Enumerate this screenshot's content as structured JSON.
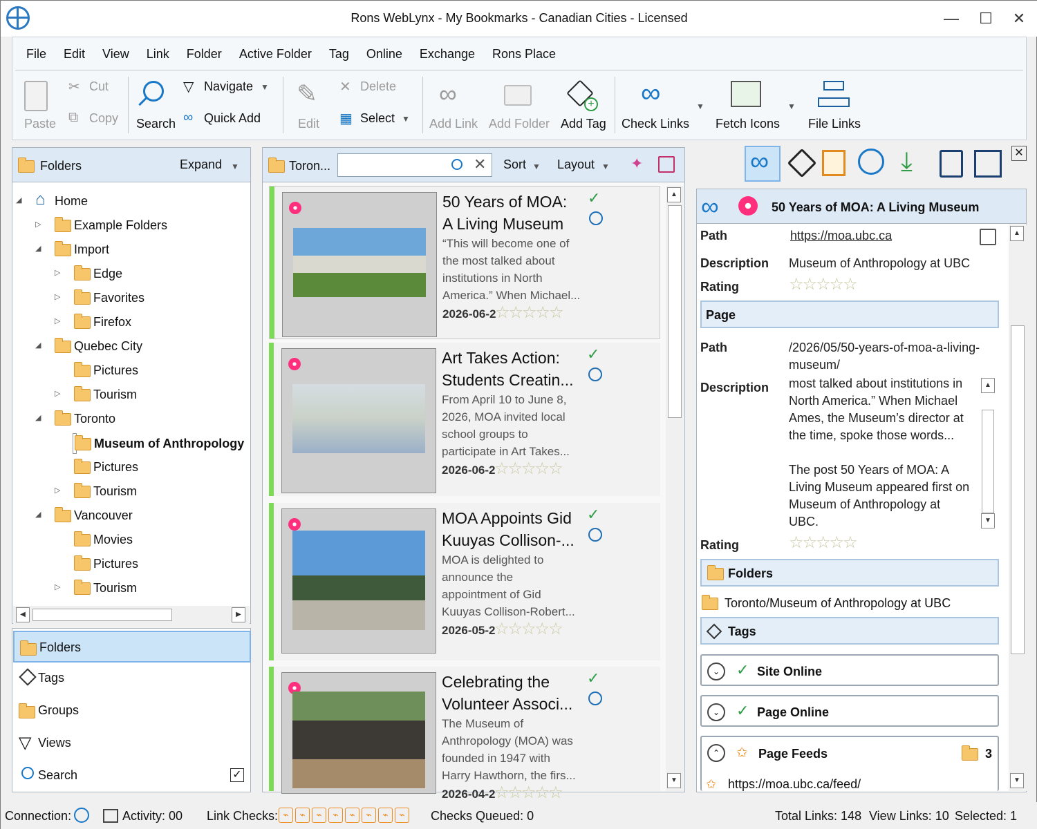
{
  "window": {
    "title": "Rons WebLynx - My Bookmarks - Canadian Cities - Licensed"
  },
  "menu": [
    "File",
    "Edit",
    "View",
    "Link",
    "Folder",
    "Active Folder",
    "Tag",
    "Online",
    "Exchange",
    "Rons Place"
  ],
  "toolbar": {
    "paste": "Paste",
    "cut": "Cut",
    "copy": "Copy",
    "search": "Search",
    "navigate": "Navigate",
    "quick_add": "Quick Add",
    "edit": "Edit",
    "delete": "Delete",
    "select": "Select",
    "add_link": "Add Link",
    "add_folder": "Add Folder",
    "add_tag": "Add Tag",
    "check_links": "Check Links",
    "fetch_icons": "Fetch Icons",
    "file_links": "File Links"
  },
  "folders_panel": {
    "title": "Folders",
    "expand": "Expand",
    "tree": [
      {
        "label": "Home"
      },
      {
        "label": "Example Folders"
      },
      {
        "label": "Import"
      },
      {
        "label": "Edge"
      },
      {
        "label": "Favorites"
      },
      {
        "label": "Firefox"
      },
      {
        "label": "Quebec City"
      },
      {
        "label": "Pictures"
      },
      {
        "label": "Tourism"
      },
      {
        "label": "Toronto"
      },
      {
        "label": "Museum of Anthropology"
      },
      {
        "label": "Pictures"
      },
      {
        "label": "Tourism"
      },
      {
        "label": "Vancouver"
      },
      {
        "label": "Movies"
      },
      {
        "label": "Pictures"
      },
      {
        "label": "Tourism"
      }
    ]
  },
  "nav": {
    "folders": "Folders",
    "tags": "Tags",
    "groups": "Groups",
    "views": "Views",
    "search": "Search"
  },
  "list_panel": {
    "folder": "Toron...",
    "search_value": "",
    "sort": "Sort",
    "layout": "Layout",
    "cards": [
      {
        "title1": "50 Years of MOA:",
        "title2": "A Living Museum",
        "desc": [
          "“This will become one of",
          "the most talked about",
          "institutions in North",
          "America.” When Michael..."
        ],
        "date": "2026-06-2"
      },
      {
        "title1": "Art Takes Action:",
        "title2": "Students Creatin...",
        "desc": [
          "From April 10 to June 8,",
          "2026, MOA invited local",
          "school groups to",
          "participate in Art Takes..."
        ],
        "date": "2026-06-2"
      },
      {
        "title1": "MOA Appoints Gid",
        "title2": "Kuuyas Collison-...",
        "desc": [
          "MOA is delighted to",
          "announce the",
          "appointment of Gid",
          "Kuuyas Collison-Robert..."
        ],
        "date": "2026-05-2"
      },
      {
        "title1": "Celebrating the",
        "title2": "Volunteer Associ...",
        "desc": [
          "The Museum of",
          "Anthropology (MOA) was",
          "founded in 1947 with",
          "Harry Hawthorn, the firs..."
        ],
        "date": "2026-04-2"
      }
    ]
  },
  "details": {
    "header": "50 Years of MOA: A Living Museum",
    "path_label": "Path",
    "path": "https://moa.ubc.ca",
    "desc_label": "Description",
    "desc": "Museum of Anthropology at UBC",
    "rating_label": "Rating",
    "page_section": "Page",
    "page_path": [
      "/2026/05/50-years-of-moa-a-living-",
      "museum/"
    ],
    "page_desc": [
      "most talked about institutions in",
      "North America.” When Michael",
      "Ames, the Museum’s director at",
      "the time, spoke those words...",
      "",
      "The post 50 Years of MOA: A",
      "Living Museum appeared first on",
      "Museum of Anthropology at",
      "UBC."
    ],
    "folders_section": "Folders",
    "folder_path": "Toronto/Museum of Anthropology at UBC",
    "tags_section": "Tags",
    "site_online": "Site Online",
    "page_online": "Page Online",
    "page_feeds": "Page Feeds",
    "feeds_count": "3",
    "feed_url": "https://moa.ubc.ca/feed/"
  },
  "status": {
    "connection": "Connection:",
    "activity": "Activity: 00",
    "link_checks": "Link Checks:",
    "checks_queued": "Checks Queued: 0",
    "total_links": "Total Links: 148",
    "view_links": "View Links: 10",
    "selected": "Selected: 1"
  }
}
